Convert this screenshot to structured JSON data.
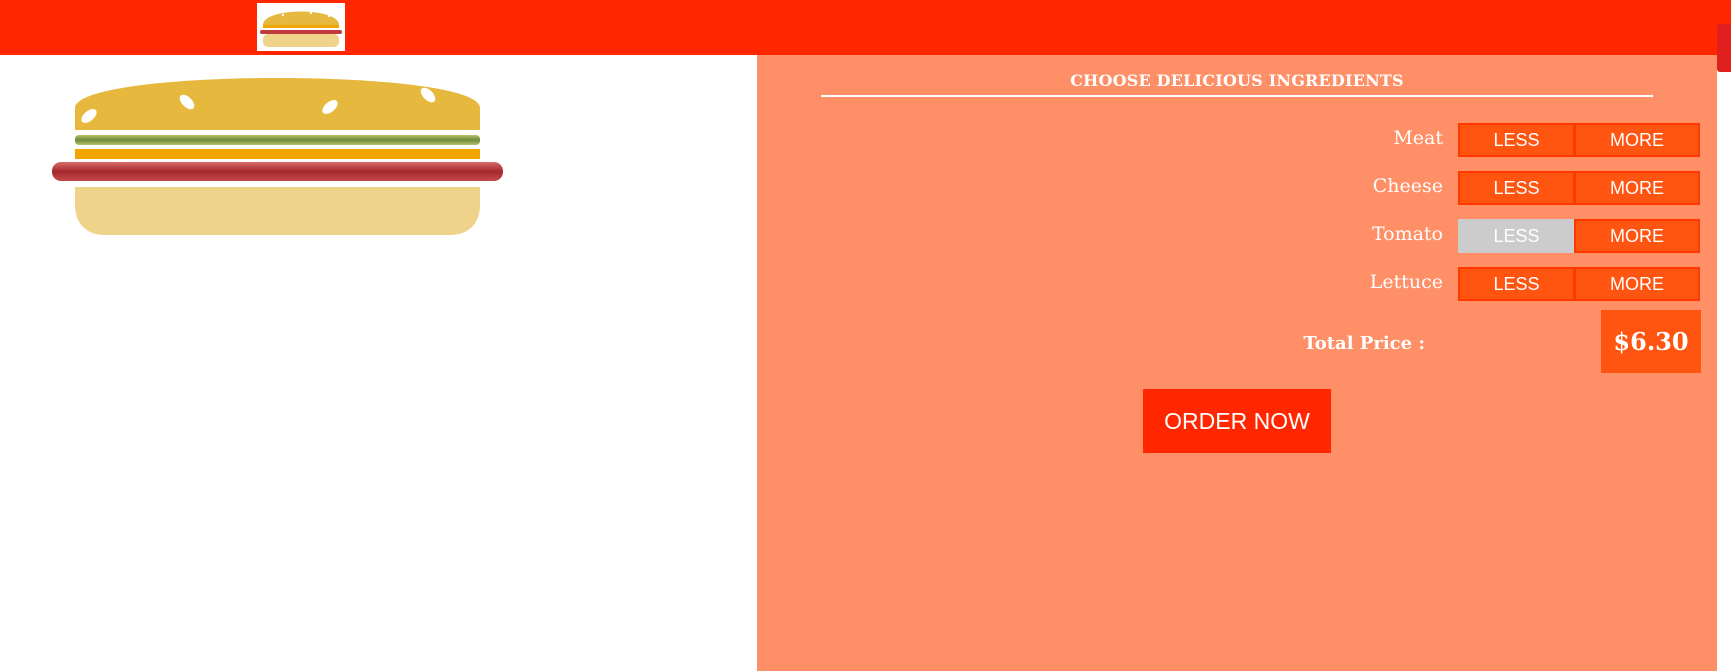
{
  "header": {
    "logo_icon": "burger-logo-icon",
    "bar_color": "#ff2600"
  },
  "burger": {
    "icon": "burger-illustration",
    "layers": [
      "top-bun",
      "lettuce",
      "cheese",
      "tomato",
      "bottom-bun"
    ]
  },
  "builder": {
    "title": "CHOOSE DELICIOUS INGREDIENTS",
    "ingredients": [
      {
        "label": "Meat",
        "less_label": "LESS",
        "more_label": "MORE",
        "less_disabled": false
      },
      {
        "label": "Cheese",
        "less_label": "LESS",
        "more_label": "MORE",
        "less_disabled": false
      },
      {
        "label": "Tomato",
        "less_label": "LESS",
        "more_label": "MORE",
        "less_disabled": true
      },
      {
        "label": "Lettuce",
        "less_label": "LESS",
        "more_label": "MORE",
        "less_disabled": false
      }
    ],
    "total_label": "Total Price :",
    "total_value": "$6.30",
    "order_label": "ORDER NOW"
  },
  "colors": {
    "accent": "#ff2600",
    "button": "#ff5511",
    "panel": "#ff8f66",
    "disabled": "#cccccc"
  }
}
